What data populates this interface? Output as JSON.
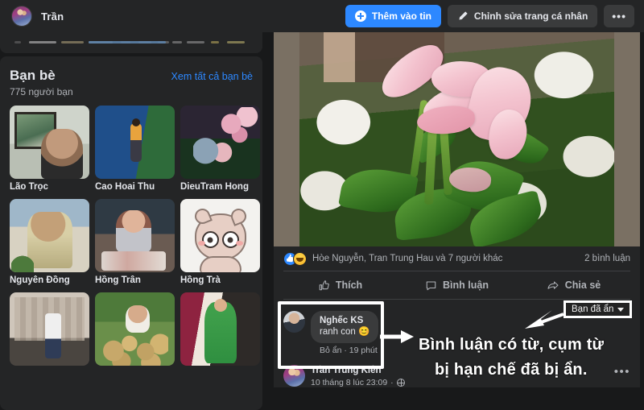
{
  "topbar": {
    "profile_name": "Trần",
    "add_story_label": "Thêm vào tin",
    "edit_profile_label": "Chỉnh sửa trang cá nhân",
    "more_label": "•••",
    "primary_color": "#2d88ff"
  },
  "friends_card": {
    "title": "Bạn bè",
    "see_all_label": "Xem tất cả bạn bè",
    "count_label": "775 người bạn",
    "items": [
      {
        "name": "Lão Trọc"
      },
      {
        "name": "Cao Hoai Thu"
      },
      {
        "name": "DieuTram Hong"
      },
      {
        "name": "Nguyễn Đồng"
      },
      {
        "name": "Hồng Trân"
      },
      {
        "name": "Hồng Trà"
      },
      {
        "name": ""
      },
      {
        "name": ""
      },
      {
        "name": ""
      }
    ]
  },
  "post": {
    "reactions_text": "Hòe Nguyễn, Tran Trung Hau và 7 người khác",
    "comments_count": "2 bình luận",
    "actions": [
      {
        "label": "Thích",
        "icon": "thumbs-up-icon"
      },
      {
        "label": "Bình luận",
        "icon": "comment-bubble-icon"
      },
      {
        "label": "Chia sẻ",
        "icon": "share-arrow-icon"
      }
    ]
  },
  "comments": [
    {
      "author": "Nghếc KS",
      "text": "ranh con 😊",
      "meta": "Bỏ ẩn · 19 phút",
      "hidden": true
    },
    {
      "author": "Trần Trung Kiên",
      "timestamp": "10 tháng 8 lúc 23:09",
      "privacy_icon": "globe-icon",
      "more_label": "•••"
    }
  ],
  "annotations": {
    "hidden_badge_label": "Bạn đã ẩn",
    "caption_line1": "Bình luận có từ, cụm từ",
    "caption_line2": "bị hạn chế đã bị ẩn.",
    "highlight_color": "#ffffff"
  }
}
